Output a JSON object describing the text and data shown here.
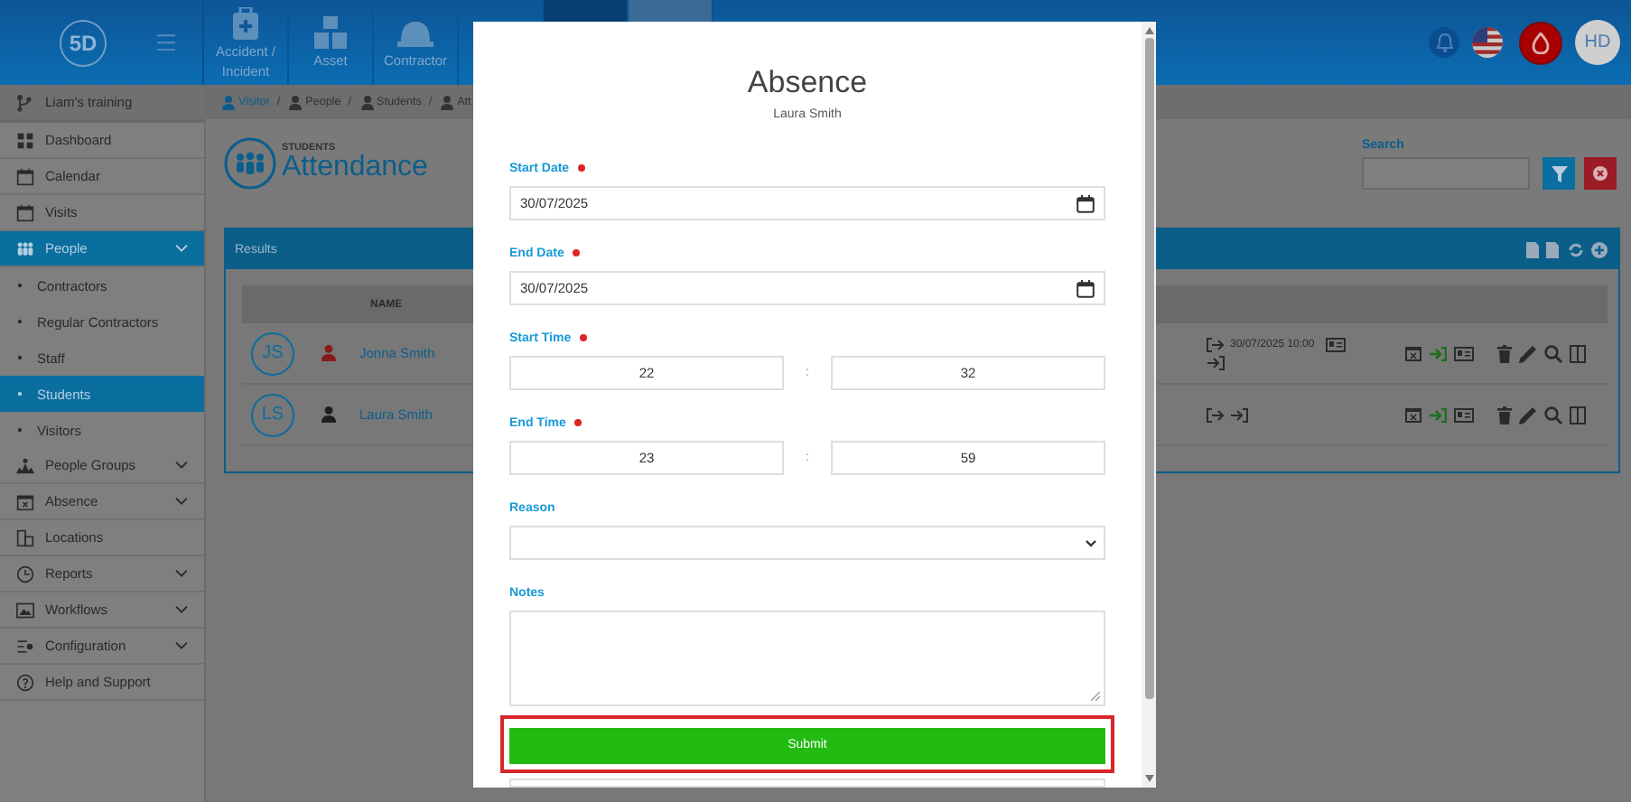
{
  "topbar": {
    "logo": "5D",
    "modules": [
      {
        "label": "Accident / Incident"
      },
      {
        "label": "Asset"
      },
      {
        "label": "Contractor"
      }
    ],
    "avatar": "HD"
  },
  "sidebar": {
    "header": "Liam's training",
    "items": [
      {
        "label": "Dashboard",
        "selected": false,
        "submenu": false
      },
      {
        "label": "Calendar",
        "selected": false,
        "submenu": false
      },
      {
        "label": "Visits",
        "selected": false,
        "submenu": false
      },
      {
        "label": "People",
        "selected": true,
        "submenu": true,
        "children": [
          {
            "label": "Contractors",
            "selected": false
          },
          {
            "label": "Regular Contractors",
            "selected": false
          },
          {
            "label": "Staff",
            "selected": false
          },
          {
            "label": "Students",
            "selected": true
          },
          {
            "label": "Visitors",
            "selected": false
          }
        ]
      },
      {
        "label": "People Groups",
        "selected": false,
        "submenu": true
      },
      {
        "label": "Absence",
        "selected": false,
        "submenu": true
      },
      {
        "label": "Locations",
        "selected": false,
        "submenu": false
      },
      {
        "label": "Reports",
        "selected": false,
        "submenu": true
      },
      {
        "label": "Workflows",
        "selected": false,
        "submenu": true
      },
      {
        "label": "Configuration",
        "selected": false,
        "submenu": true
      },
      {
        "label": "Help and Support",
        "selected": false,
        "submenu": false
      }
    ]
  },
  "breadcrumb": [
    {
      "label": "Visitor",
      "separator": "/"
    },
    {
      "label": "People",
      "separator": "/"
    },
    {
      "label": "Students",
      "separator": "/"
    },
    {
      "label": "Att"
    }
  ],
  "header": {
    "overline": "STUDENTS",
    "title": "Attendance"
  },
  "search": {
    "label": "Search"
  },
  "results": {
    "title": "Results",
    "columns": [
      "NAME"
    ],
    "rows": [
      {
        "initials": "JS",
        "name": "Jonna Smith",
        "color": "#8a1a1a",
        "time": "30/07/2025 10:00"
      },
      {
        "initials": "LS",
        "name": "Laura Smith",
        "color": "#1e1e1e"
      }
    ]
  },
  "modal": {
    "title": "Absence",
    "subtitle": "Laura Smith",
    "fields": [
      {
        "kind": "date",
        "label": "Start Date",
        "required": true,
        "value": "30/07/2025"
      },
      {
        "kind": "date",
        "label": "End Date",
        "required": true,
        "value": "30/07/2025"
      },
      {
        "kind": "time",
        "label": "Start Time",
        "required": true,
        "hours": "22",
        "separator": ":",
        "minutes": "32"
      },
      {
        "kind": "time",
        "label": "End Time",
        "required": true,
        "hours": "23",
        "separator": ":",
        "minutes": "59"
      },
      {
        "kind": "select",
        "label": "Reason",
        "required": false
      },
      {
        "kind": "textarea",
        "label": "Notes",
        "required": false
      }
    ],
    "submit": "Submit",
    "submit_highlighted": true
  }
}
